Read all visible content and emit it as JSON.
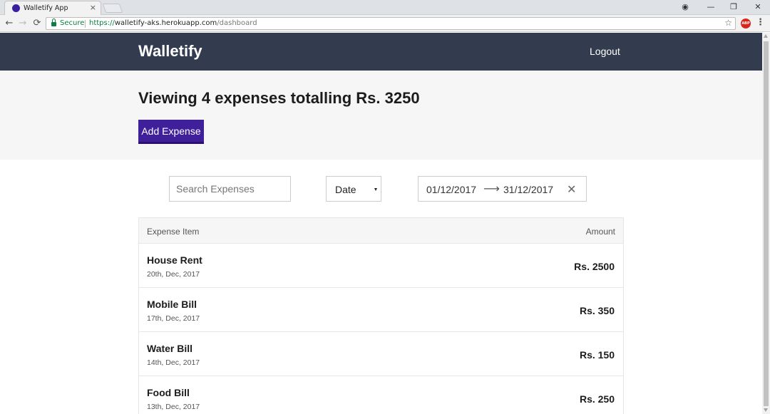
{
  "browser": {
    "tab_title": "Walletify App",
    "tab_close": "×",
    "secure_label": "Secure",
    "url_scheme": "https://",
    "url_host": "walletify-aks.herokuapp.com",
    "url_path": "/dashboard",
    "abp_label": "ABP",
    "icons": {
      "back": "←",
      "forward": "→",
      "reload": "⟳",
      "star": "☆",
      "menu": "⋮",
      "profile": "◉",
      "minimize": "—",
      "restore": "❐",
      "close": "✕"
    }
  },
  "header": {
    "brand": "Walletify",
    "logout": "Logout"
  },
  "summary": {
    "prefix": "Viewing ",
    "count": "4",
    "middle": " expenses totalling ",
    "total": "Rs. 3250",
    "add_button": "Add Expense"
  },
  "filters": {
    "search_placeholder": "Search Expenses",
    "sort_value": "Date",
    "start_date": "01/12/2017",
    "arrow": "⟶",
    "end_date": "31/12/2017",
    "clear": "✕"
  },
  "table": {
    "col_item": "Expense Item",
    "col_amount": "Amount",
    "rows": [
      {
        "title": "House Rent",
        "date": "20th, Dec, 2017",
        "amount": "Rs. 2500"
      },
      {
        "title": "Mobile Bill",
        "date": "17th, Dec, 2017",
        "amount": "Rs. 350"
      },
      {
        "title": "Water Bill",
        "date": "14th, Dec, 2017",
        "amount": "Rs. 150"
      },
      {
        "title": "Food Bill",
        "date": "13th, Dec, 2017",
        "amount": "Rs. 250"
      }
    ]
  },
  "colors": {
    "header_bg": "#333c4e",
    "accent": "#3f1f9a",
    "summary_bg": "#f6f6f7",
    "secure_green": "#0b8043"
  }
}
